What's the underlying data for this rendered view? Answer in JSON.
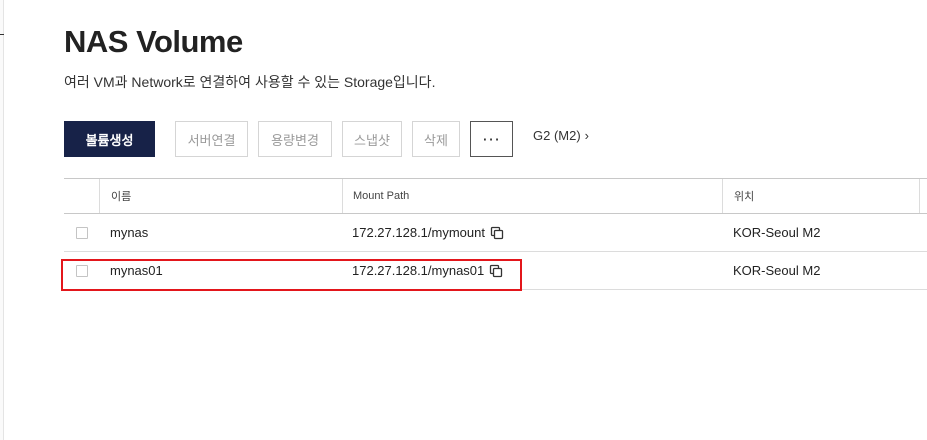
{
  "page": {
    "title": "NAS Volume",
    "description": "여러 VM과 Network로 연결하여 사용할 수 있는 Storage입니다."
  },
  "toolbar": {
    "create_label": "볼륨생성",
    "connect_server_label": "서버연결",
    "resize_label": "용량변경",
    "snapshot_label": "스냅샷",
    "delete_label": "삭제",
    "more_label": "···"
  },
  "region": {
    "label": "G2 (M2)",
    "chevron": "›"
  },
  "table": {
    "columns": {
      "name": "이름",
      "mount_path": "Mount Path",
      "location": "위치"
    },
    "rows": [
      {
        "name": "mynas",
        "mount_path": "172.27.128.1/mymount",
        "location": "KOR-Seoul M2"
      },
      {
        "name": "mynas01",
        "mount_path": "172.27.128.1/mynas01",
        "location": "KOR-Seoul M2"
      }
    ]
  },
  "colors": {
    "primary_button": "#172248",
    "highlight_border": "#e3161b"
  },
  "icons": {
    "copy": "copy-icon",
    "checkbox": "checkbox"
  }
}
